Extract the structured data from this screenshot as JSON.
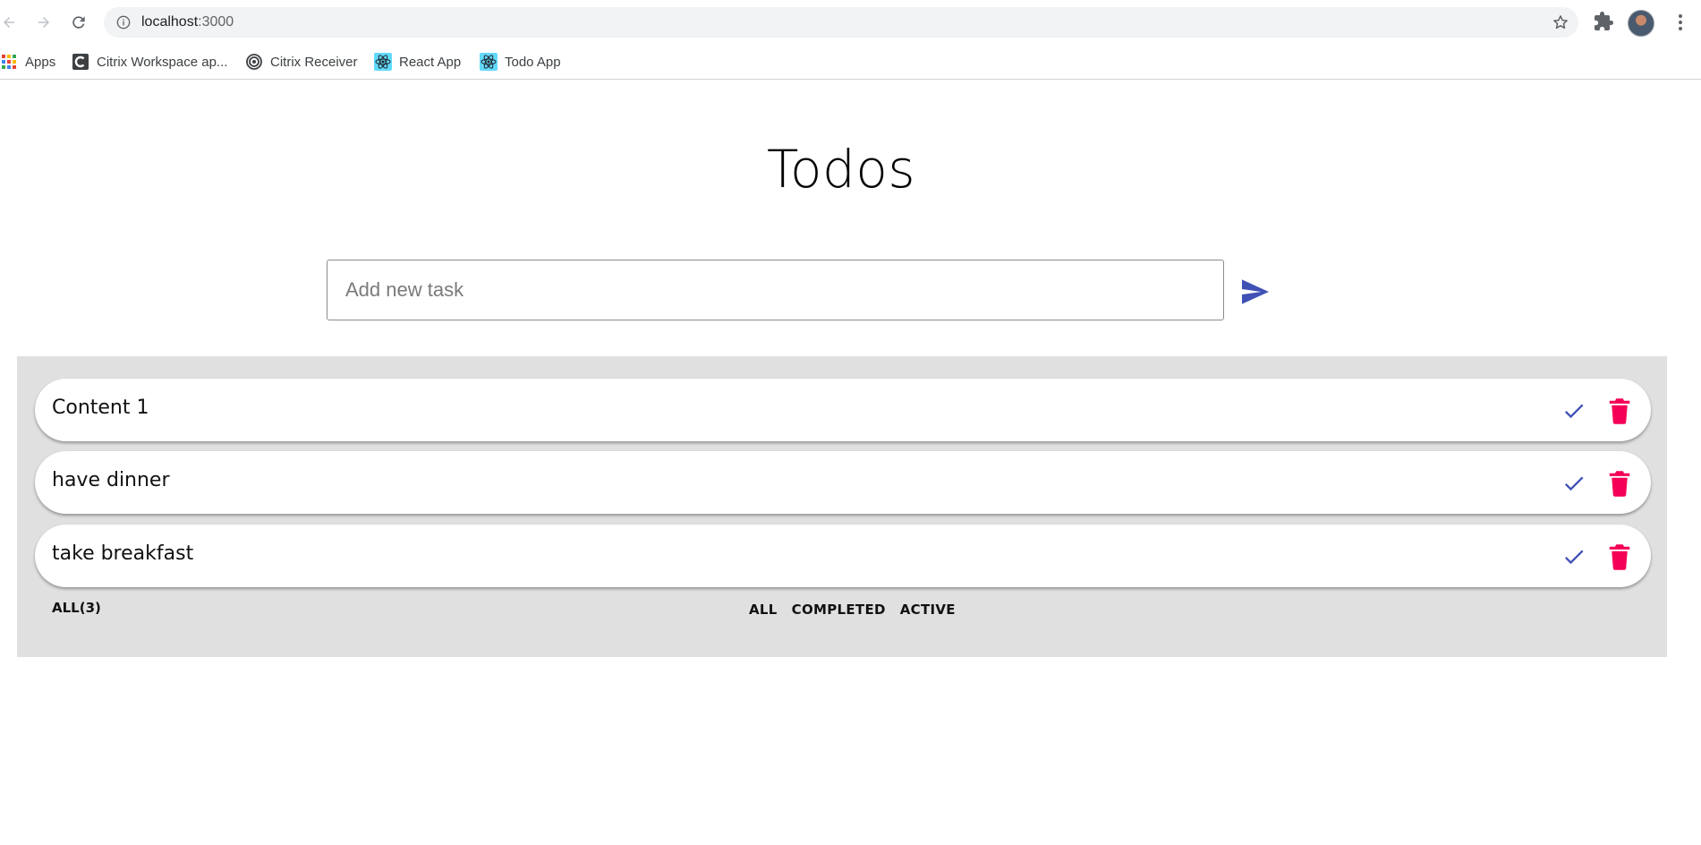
{
  "browser": {
    "url_host": "localhost",
    "url_port": ":3000",
    "bookmarks": [
      {
        "label": "Apps",
        "icon": "apps-grid-icon"
      },
      {
        "label": "Citrix Workspace ap...",
        "icon": "citrix-workspace-icon"
      },
      {
        "label": "Citrix Receiver",
        "icon": "citrix-receiver-icon"
      },
      {
        "label": "React App",
        "icon": "react-icon"
      },
      {
        "label": "Todo App",
        "icon": "react-icon"
      }
    ]
  },
  "app": {
    "title": "Todos",
    "input": {
      "placeholder": "Add new task",
      "value": ""
    },
    "todos": [
      {
        "text": "Content 1"
      },
      {
        "text": "have dinner"
      },
      {
        "text": "take breakfast"
      }
    ],
    "count_label": "ALL(3)",
    "filters": [
      "ALL",
      "COMPLETED",
      "ACTIVE"
    ]
  },
  "colors": {
    "accent": "#3f51b5",
    "delete": "#f50057",
    "panel": "#e0e0e0"
  }
}
